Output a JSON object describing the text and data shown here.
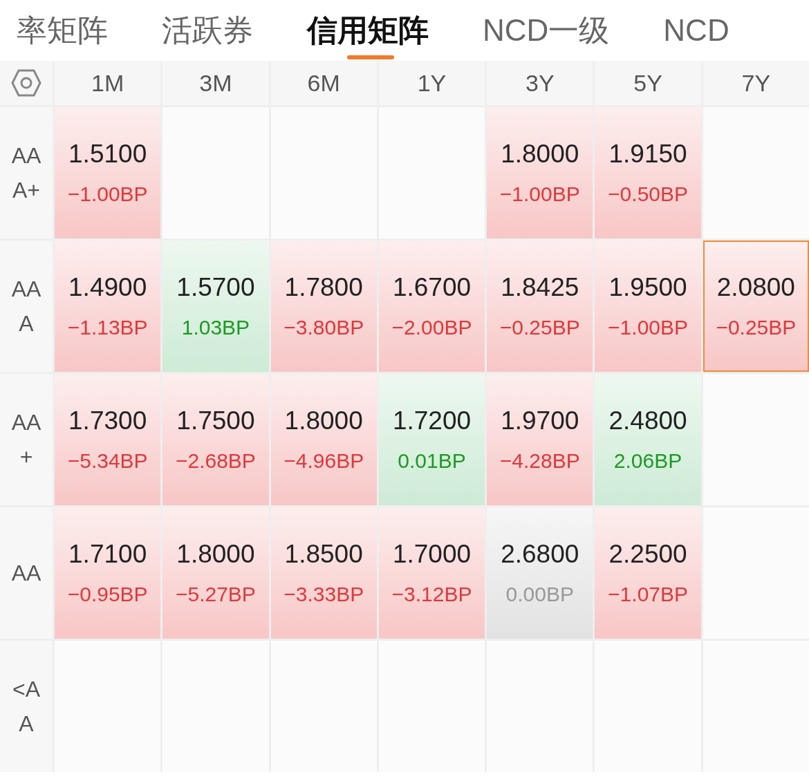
{
  "tabs": [
    {
      "label": "率矩阵",
      "selected": false
    },
    {
      "label": "活跃券",
      "selected": false
    },
    {
      "label": "信用矩阵",
      "selected": true
    },
    {
      "label": "NCD一级",
      "selected": false
    },
    {
      "label": "NCD",
      "selected": false
    }
  ],
  "matrix": {
    "columns": [
      "1M",
      "3M",
      "6M",
      "1Y",
      "3Y",
      "5Y",
      "7Y"
    ],
    "rows": [
      {
        "label": "AAA+",
        "cells": [
          {
            "value": "1.5100",
            "change": "−1.00BP",
            "kind": "down",
            "selected": false
          },
          null,
          null,
          null,
          {
            "value": "1.8000",
            "change": "−1.00BP",
            "kind": "down",
            "selected": false
          },
          {
            "value": "1.9150",
            "change": "−0.50BP",
            "kind": "down",
            "selected": false
          },
          null
        ]
      },
      {
        "label": "AAA",
        "cells": [
          {
            "value": "1.4900",
            "change": "−1.13BP",
            "kind": "down",
            "selected": false
          },
          {
            "value": "1.5700",
            "change": "1.03BP",
            "kind": "up",
            "selected": false
          },
          {
            "value": "1.7800",
            "change": "−3.80BP",
            "kind": "down",
            "selected": false
          },
          {
            "value": "1.6700",
            "change": "−2.00BP",
            "kind": "down",
            "selected": false
          },
          {
            "value": "1.8425",
            "change": "−0.25BP",
            "kind": "down",
            "selected": false
          },
          {
            "value": "1.9500",
            "change": "−1.00BP",
            "kind": "down",
            "selected": false
          },
          {
            "value": "2.0800",
            "change": "−0.25BP",
            "kind": "down",
            "selected": true
          }
        ]
      },
      {
        "label": "AA+",
        "cells": [
          {
            "value": "1.7300",
            "change": "−5.34BP",
            "kind": "down",
            "selected": false
          },
          {
            "value": "1.7500",
            "change": "−2.68BP",
            "kind": "down",
            "selected": false
          },
          {
            "value": "1.8000",
            "change": "−4.96BP",
            "kind": "down",
            "selected": false
          },
          {
            "value": "1.7200",
            "change": "0.01BP",
            "kind": "up",
            "selected": false
          },
          {
            "value": "1.9700",
            "change": "−4.28BP",
            "kind": "down",
            "selected": false
          },
          {
            "value": "2.4800",
            "change": "2.06BP",
            "kind": "up",
            "selected": false
          },
          null
        ]
      },
      {
        "label": "AA",
        "cells": [
          {
            "value": "1.7100",
            "change": "−0.95BP",
            "kind": "down",
            "selected": false
          },
          {
            "value": "1.8000",
            "change": "−5.27BP",
            "kind": "down",
            "selected": false
          },
          {
            "value": "1.8500",
            "change": "−3.33BP",
            "kind": "down",
            "selected": false
          },
          {
            "value": "1.7000",
            "change": "−3.12BP",
            "kind": "down",
            "selected": false
          },
          {
            "value": "2.6800",
            "change": "0.00BP",
            "kind": "flat",
            "selected": false
          },
          {
            "value": "2.2500",
            "change": "−1.07BP",
            "kind": "down",
            "selected": false
          },
          null
        ]
      },
      {
        "label": "<AA",
        "cells": [
          null,
          null,
          null,
          null,
          null,
          null,
          null
        ]
      }
    ]
  }
}
